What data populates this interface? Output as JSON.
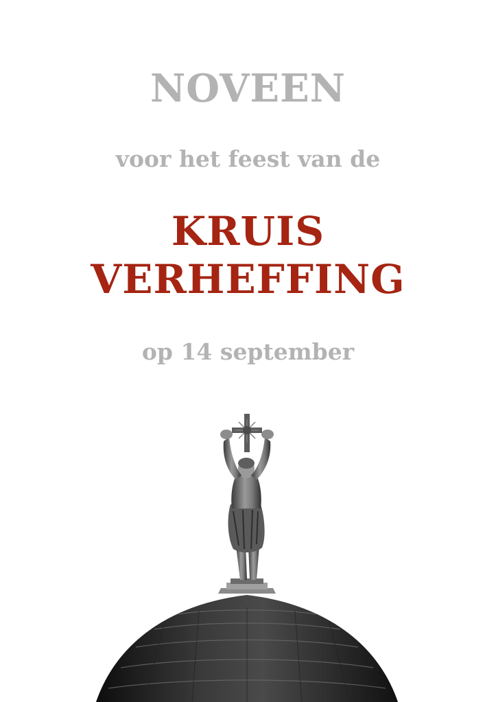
{
  "cover": {
    "title": "NOVEEN",
    "subtitle": "voor het feest van de",
    "feast_line1": "KRUIS",
    "feast_line2": "VERHEFFING",
    "date": "op 14 september"
  },
  "colors": {
    "grey_text": "#b3b3b3",
    "accent_red": "#a52412",
    "background": "#ffffff"
  },
  "image": {
    "icon": "statue-holding-cross-on-dome-icon"
  }
}
